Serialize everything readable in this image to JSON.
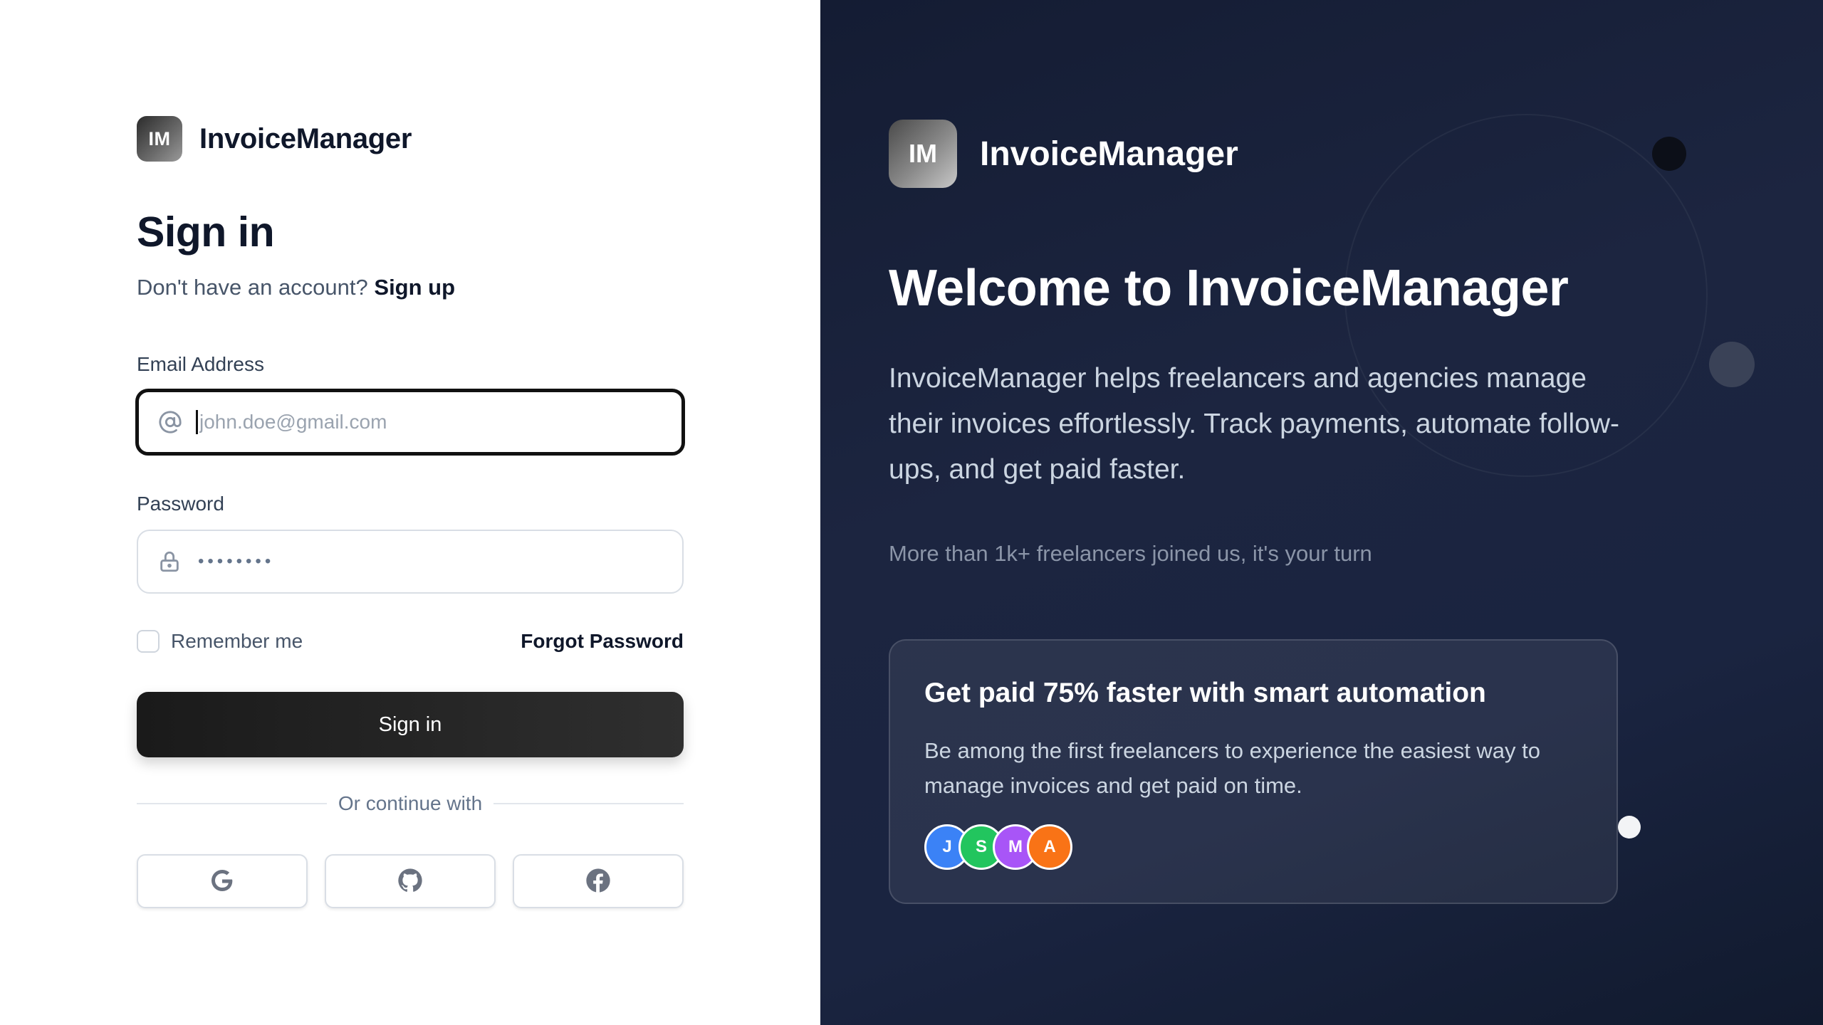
{
  "brand": {
    "initials": "IM",
    "name": "InvoiceManager"
  },
  "signin": {
    "title": "Sign in",
    "no_account": "Don't have an account?",
    "signup_link": "Sign up",
    "email_label": "Email Address",
    "email_placeholder": "john.doe@gmail.com",
    "password_label": "Password",
    "password_mask": "••••••••",
    "remember_label": "Remember me",
    "forgot_label": "Forgot Password",
    "submit_label": "Sign in",
    "divider_text": "Or continue with",
    "social": [
      {
        "name": "google",
        "icon": "google-icon"
      },
      {
        "name": "github",
        "icon": "github-icon"
      },
      {
        "name": "facebook",
        "icon": "facebook-icon"
      }
    ]
  },
  "promo": {
    "welcome": "Welcome to InvoiceManager",
    "description": "InvoiceManager helps freelancers and agencies manage their invoices effortlessly. Track payments, automate follow-ups, and get paid faster.",
    "joined": "More than 1k+ freelancers joined us, it's your turn",
    "card_title": "Get paid 75% faster with smart automation",
    "card_text": "Be among the first freelancers to experience the easiest way to manage invoices and get paid on time.",
    "avatars": [
      {
        "letter": "J",
        "color": "#3b82f6"
      },
      {
        "letter": "S",
        "color": "#22c55e"
      },
      {
        "letter": "M",
        "color": "#a855f7"
      },
      {
        "letter": "A",
        "color": "#f97316"
      }
    ]
  },
  "colors": {
    "panel_dark": "#1c2540",
    "button_dark": "#1a1a1a",
    "text_primary": "#0f172a"
  }
}
